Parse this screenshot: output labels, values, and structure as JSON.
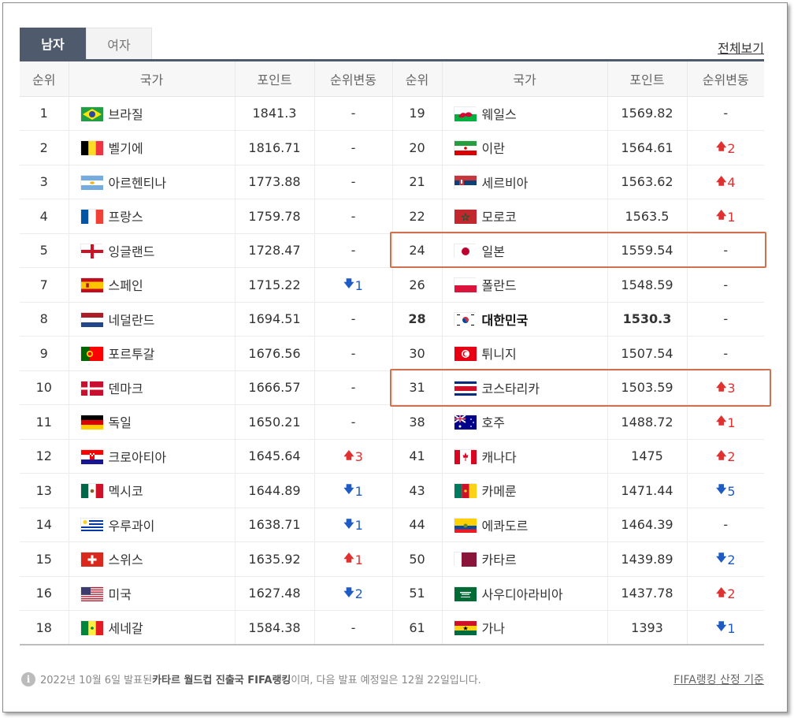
{
  "tabs": [
    {
      "label": "남자",
      "active": true
    },
    {
      "label": "여자",
      "active": false
    }
  ],
  "view_all": "전체보기",
  "columns": {
    "rank": "순위",
    "country": "국가",
    "points": "포인트",
    "change": "순위변동"
  },
  "colors": {
    "up": "#e03131",
    "down": "#1f5bc4",
    "highlight": "#d0704e",
    "tab_active": "#4f5a6d"
  },
  "left_rows": [
    {
      "rank": "1",
      "country": "브라질",
      "points": "1841.3",
      "dir": "none",
      "change": "-",
      "flag": "brazil-flag"
    },
    {
      "rank": "2",
      "country": "벨기에",
      "points": "1816.71",
      "dir": "none",
      "change": "-",
      "flag": "belgium-flag"
    },
    {
      "rank": "3",
      "country": "아르헨티나",
      "points": "1773.88",
      "dir": "none",
      "change": "-",
      "flag": "argentina-flag"
    },
    {
      "rank": "4",
      "country": "프랑스",
      "points": "1759.78",
      "dir": "none",
      "change": "-",
      "flag": "france-flag"
    },
    {
      "rank": "5",
      "country": "잉글랜드",
      "points": "1728.47",
      "dir": "none",
      "change": "-",
      "flag": "england-flag"
    },
    {
      "rank": "7",
      "country": "스페인",
      "points": "1715.22",
      "dir": "down",
      "change": "1",
      "flag": "spain-flag"
    },
    {
      "rank": "8",
      "country": "네덜란드",
      "points": "1694.51",
      "dir": "none",
      "change": "-",
      "flag": "netherlands-flag"
    },
    {
      "rank": "9",
      "country": "포르투갈",
      "points": "1676.56",
      "dir": "none",
      "change": "-",
      "flag": "portugal-flag"
    },
    {
      "rank": "10",
      "country": "덴마크",
      "points": "1666.57",
      "dir": "none",
      "change": "-",
      "flag": "denmark-flag"
    },
    {
      "rank": "11",
      "country": "독일",
      "points": "1650.21",
      "dir": "none",
      "change": "-",
      "flag": "germany-flag"
    },
    {
      "rank": "12",
      "country": "크로아티아",
      "points": "1645.64",
      "dir": "up",
      "change": "3",
      "flag": "croatia-flag"
    },
    {
      "rank": "13",
      "country": "멕시코",
      "points": "1644.89",
      "dir": "down",
      "change": "1",
      "flag": "mexico-flag"
    },
    {
      "rank": "14",
      "country": "우루과이",
      "points": "1638.71",
      "dir": "down",
      "change": "1",
      "flag": "uruguay-flag"
    },
    {
      "rank": "15",
      "country": "스위스",
      "points": "1635.92",
      "dir": "up",
      "change": "1",
      "flag": "switzerland-flag"
    },
    {
      "rank": "16",
      "country": "미국",
      "points": "1627.48",
      "dir": "down",
      "change": "2",
      "flag": "usa-flag"
    },
    {
      "rank": "18",
      "country": "세네갈",
      "points": "1584.38",
      "dir": "none",
      "change": "-",
      "flag": "senegal-flag"
    }
  ],
  "right_rows": [
    {
      "rank": "19",
      "country": "웨일스",
      "points": "1569.82",
      "dir": "none",
      "change": "-",
      "flag": "wales-flag"
    },
    {
      "rank": "20",
      "country": "이란",
      "points": "1564.61",
      "dir": "up",
      "change": "2",
      "flag": "iran-flag"
    },
    {
      "rank": "21",
      "country": "세르비아",
      "points": "1563.62",
      "dir": "up",
      "change": "4",
      "flag": "serbia-flag"
    },
    {
      "rank": "22",
      "country": "모로코",
      "points": "1563.5",
      "dir": "up",
      "change": "1",
      "flag": "morocco-flag"
    },
    {
      "rank": "24",
      "country": "일본",
      "points": "1559.54",
      "dir": "none",
      "change": "-",
      "flag": "japan-flag"
    },
    {
      "rank": "26",
      "country": "폴란드",
      "points": "1548.59",
      "dir": "none",
      "change": "-",
      "flag": "poland-flag"
    },
    {
      "rank": "28",
      "country": "대한민국",
      "points": "1530.3",
      "dir": "none",
      "change": "-",
      "flag": "korea-flag",
      "bold": true
    },
    {
      "rank": "30",
      "country": "튀니지",
      "points": "1507.54",
      "dir": "none",
      "change": "-",
      "flag": "tunisia-flag"
    },
    {
      "rank": "31",
      "country": "코스타리카",
      "points": "1503.59",
      "dir": "up",
      "change": "3",
      "flag": "costa-rica-flag"
    },
    {
      "rank": "38",
      "country": "호주",
      "points": "1488.72",
      "dir": "up",
      "change": "1",
      "flag": "australia-flag"
    },
    {
      "rank": "41",
      "country": "캐나다",
      "points": "1475",
      "dir": "up",
      "change": "2",
      "flag": "canada-flag"
    },
    {
      "rank": "43",
      "country": "카메룬",
      "points": "1471.44",
      "dir": "down",
      "change": "5",
      "flag": "cameroon-flag"
    },
    {
      "rank": "44",
      "country": "에콰도르",
      "points": "1464.39",
      "dir": "none",
      "change": "-",
      "flag": "ecuador-flag"
    },
    {
      "rank": "50",
      "country": "카타르",
      "points": "1439.89",
      "dir": "down",
      "change": "2",
      "flag": "qatar-flag"
    },
    {
      "rank": "51",
      "country": "사우디아라비아",
      "points": "1437.78",
      "dir": "up",
      "change": "2",
      "flag": "saudi-arabia-flag"
    },
    {
      "rank": "61",
      "country": "가나",
      "points": "1393",
      "dir": "down",
      "change": "1",
      "flag": "ghana-flag"
    }
  ],
  "footer": {
    "prefix": "2022년 10월 6일 발표된 ",
    "bold": "카타르 월드컵 진출국 FIFA랭킹",
    "suffix": "이며, 다음 발표 예정일은 12월 22일입니다.",
    "link": "FIFA랭킹 산정 기준"
  }
}
